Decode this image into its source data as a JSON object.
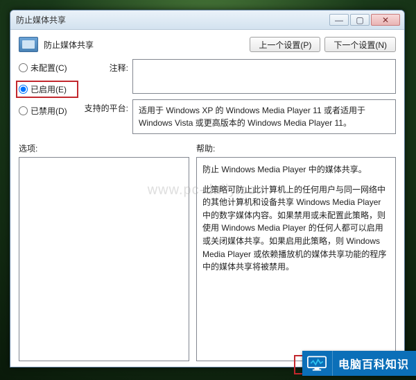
{
  "window": {
    "title": "防止媒体共享"
  },
  "header": {
    "title": "防止媒体共享",
    "prev_button": "上一个设置(P)",
    "next_button": "下一个设置(N)"
  },
  "radios": {
    "not_configured": "未配置(C)",
    "enabled": "已启用(E)",
    "disabled": "已禁用(D)",
    "selected": "enabled"
  },
  "fields": {
    "note_label": "注释:",
    "note_value": "",
    "platform_label": "支持的平台:",
    "platform_text": "适用于 Windows XP 的 Windows Media Player 11 或者适用于 Windows Vista 或更高版本的 Windows Media Player 11。"
  },
  "sections": {
    "options_label": "选项:",
    "help_label": "帮助:"
  },
  "help": {
    "p1": "防止 Windows Media Player 中的媒体共享。",
    "p2": "此策略可防止此计算机上的任何用户与同一网络中的其他计算机和设备共享 Windows Media Player 中的数字媒体内容。如果禁用或未配置此策略，则使用 Windows Media Player 的任何人都可以启用或关闭媒体共享。如果启用此策略，则 Windows Media Player 或依赖播放机的媒体共享功能的程序中的媒体共享将被禁用。"
  },
  "watermark": "www.pc-daily.com",
  "brand": {
    "text": "电脑百科知识"
  },
  "captions": {
    "min": "—",
    "max": "▢",
    "close": "✕"
  }
}
